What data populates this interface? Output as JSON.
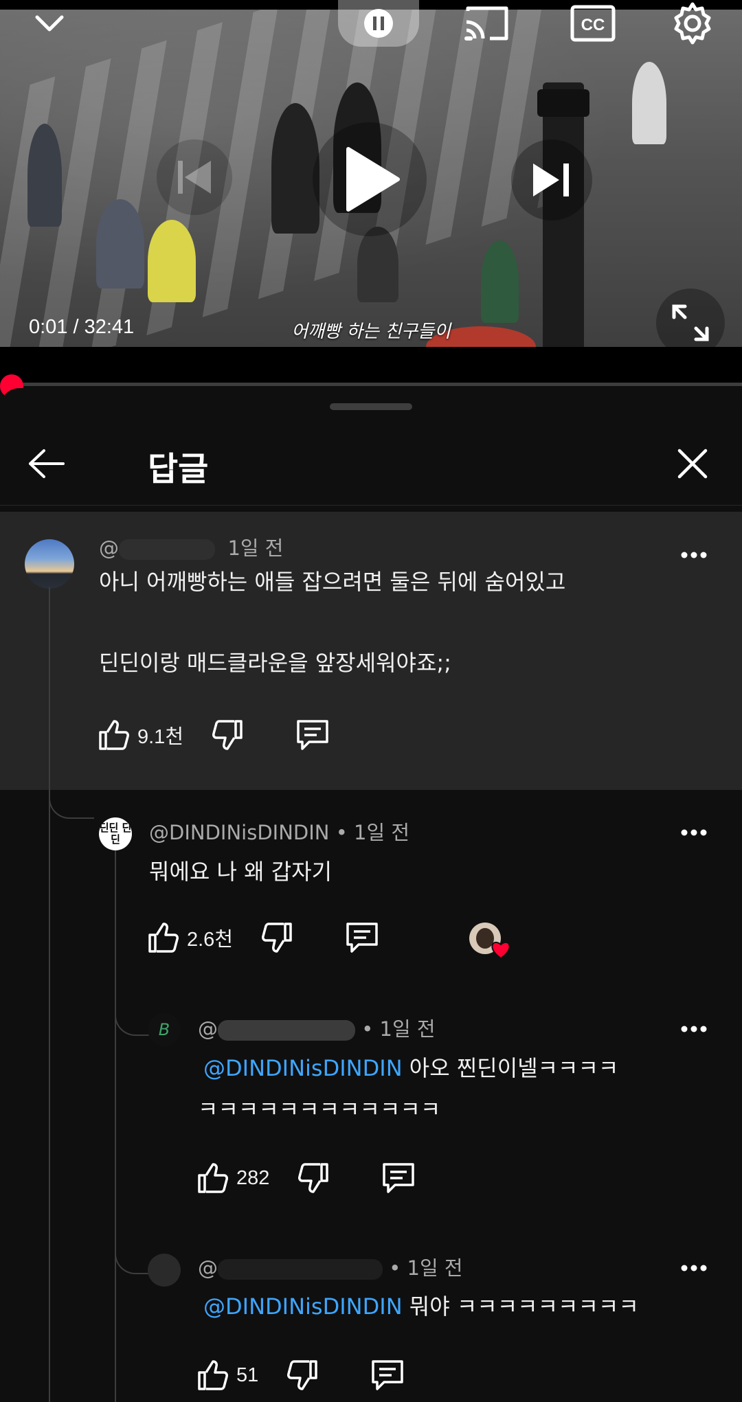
{
  "player": {
    "time_display": "0:01 / 32:41",
    "subtitle": "어깨빵 하는 친구들이",
    "progress_fraction": 0.0003
  },
  "sheet": {
    "title": "답글"
  },
  "comments": [
    {
      "author_visible": "@",
      "time": "1일 전",
      "lines": [
        "아니 어깨빵하는 애들 잡으려면 둘은 뒤에 숨어있고",
        "딘딘이랑 매드클라운을 앞장세워야죠;;"
      ],
      "likes": "9.1천"
    },
    {
      "author_visible": "@DINDINisDINDIN",
      "time": "• 1일 전",
      "avatar_text": "딘딘 딘딘",
      "lines": [
        "뭐에요 나 왜 갑자기"
      ],
      "likes": "2.6천"
    },
    {
      "author_visible": "@",
      "time": "• 1일 전",
      "avatar_text": "B",
      "mention": "@DINDINisDINDIN",
      "line1_rest": " 아오 찐딘이넬ㅋㅋㅋㅋ",
      "line2": "ㅋㅋㅋㅋㅋㅋㅋㅋㅋㅋㅋㅋ",
      "likes": "282"
    },
    {
      "author_visible": "@",
      "time": "• 1일 전",
      "mention": "@DINDINisDINDIN",
      "line1_rest": " 뭐야 ㅋㅋㅋㅋㅋㅋㅋㅋㅋ",
      "likes": "51"
    }
  ],
  "icons": {
    "collapse": "chevron-down-icon",
    "pause": "pause-icon",
    "cast": "cast-icon",
    "captions": "captions-icon",
    "settings": "gear-icon",
    "previous": "skip-previous-icon",
    "play": "play-icon",
    "next": "skip-next-icon",
    "fullscreen": "fullscreen-icon",
    "back": "arrow-back-icon",
    "close": "close-icon",
    "more": "more-vert-icon",
    "like": "thumb-up-icon",
    "dislike": "thumb-down-icon",
    "reply": "reply-icon",
    "creator_heart": "creator-heart-icon"
  },
  "colors": {
    "progress": "#ff0033",
    "mention": "#3ea6ff",
    "heart": "#ff0033",
    "background": "#0f0f0f"
  }
}
